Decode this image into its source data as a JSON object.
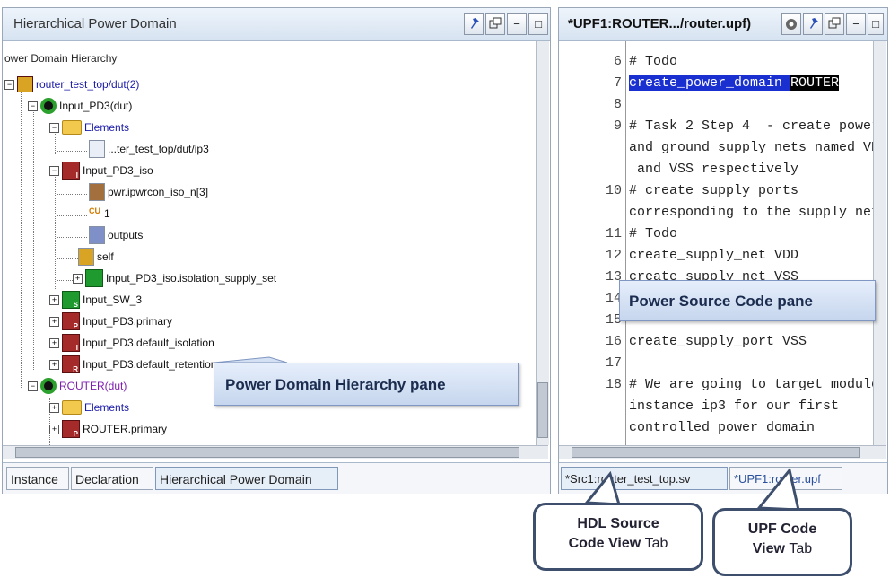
{
  "left_pane": {
    "title": "Hierarchical Power Domain",
    "tree_header": "ower Domain Hierarchy",
    "tree": {
      "root": "router_test_top/dut(2)",
      "input_pd3": "Input_PD3(dut)",
      "elements": "Elements",
      "element_path": "...ter_test_top/dut/ip3",
      "iso": "Input_PD3_iso",
      "iso_pwrcon": "pwr.ipwrcon_iso_n[3]",
      "iso_one": "1",
      "iso_outputs": "outputs",
      "iso_self": "self",
      "iso_supply_set": "Input_PD3_iso.isolation_supply_set",
      "sw3": "Input_SW_3",
      "primary": "Input_PD3.primary",
      "default_isolation": "Input_PD3.default_isolation",
      "default_retention": "Input_PD3.default_retention",
      "router": "ROUTER(dut)",
      "router_elements": "Elements",
      "router_primary": "ROUTER.primary"
    },
    "tabs": [
      "Instance",
      "Declaration",
      "Hierarchical Power Domain"
    ]
  },
  "right_pane": {
    "title": "*UPF1:ROUTER.../router.upf)",
    "code_lines": [
      {
        "num": "6",
        "text": "# Todo"
      },
      {
        "num": "7",
        "text_hl": "create_power_domain",
        "text_sel": "ROUTER"
      },
      {
        "num": "8",
        "text": ""
      },
      {
        "num": "9",
        "text": "# Task 2 Step 4  - create power"
      },
      {
        "num": "",
        "text": "and ground supply nets named VDD"
      },
      {
        "num": "",
        "text": " and VSS respectively"
      },
      {
        "num": "10",
        "text": "# create supply ports"
      },
      {
        "num": "",
        "text": "corresponding to the supply nets"
      },
      {
        "num": "11",
        "text": "# Todo"
      },
      {
        "num": "12",
        "text": "create_supply_net VDD"
      },
      {
        "num": "13",
        "text": "create_supply_net VSS"
      },
      {
        "num": "14",
        "text": ""
      },
      {
        "num": "15",
        "text": ""
      },
      {
        "num": "16",
        "text": "create_supply_port VSS"
      },
      {
        "num": "17",
        "text": ""
      },
      {
        "num": "18",
        "text": "# We are going to target module"
      },
      {
        "num": "",
        "text": "instance ip3 for our first"
      },
      {
        "num": "",
        "text": "controlled power domain"
      }
    ],
    "tabs": [
      "*Src1:router_test_top.sv",
      "*UPF1:router.upf"
    ]
  },
  "callouts": {
    "hierarchy_pane": "Power Domain Hierarchy pane",
    "source_pane": "Power Source Code pane",
    "hdl_tab_line1": "HDL Source",
    "hdl_tab_line2a": "Code View",
    "hdl_tab_line2b": "Tab",
    "upf_tab_line1": "UPF Code",
    "upf_tab_line2a": "View",
    "upf_tab_line2b": "Tab"
  },
  "colors": {
    "selection_blue": "#1a2fd0",
    "callout_fill": "#c6d6ee",
    "tree_link": "#1a1aa8",
    "domain_green": "#2ca02c"
  }
}
